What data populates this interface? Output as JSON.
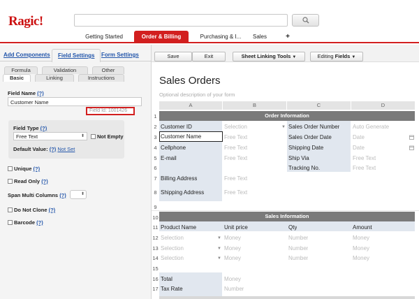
{
  "app": {
    "logo": "Ragic!"
  },
  "nav_tabs": [
    {
      "label": "Getting Started"
    },
    {
      "label": "Order & Billing"
    },
    {
      "label": "Purchasing & I..."
    },
    {
      "label": "Sales"
    },
    {
      "label": "+"
    }
  ],
  "left_panel": {
    "top_tabs": [
      "Add Components",
      "Field Settings",
      "Form Settings"
    ],
    "sub_tabs_row1": [
      "Formula",
      "Validation",
      "Other"
    ],
    "sub_tabs_row2": [
      "Basic",
      "Linking",
      "Instructions"
    ],
    "field_name_label": "Field Name",
    "help": "(?)",
    "field_name_value": "Customer Name",
    "field_id": "Field Id: 1001426",
    "field_type_label": "Field Type",
    "field_type_value": "Free Text",
    "not_empty_label": "Not Empty",
    "default_value_label": "Default Value:",
    "not_set": "Not Set",
    "unique_label": "Unique",
    "read_only_label": "Read Only",
    "span_label": "Span Multi Columns",
    "do_not_clone_label": "Do Not Clone",
    "barcode_label": "Barcode"
  },
  "toolbar": {
    "save": "Save",
    "exit": "Exit",
    "sheet_linking": "Sheet Linking Tools",
    "editing_prefix": "Editing",
    "editing_bold": "Fields"
  },
  "form": {
    "title": "Sales Orders",
    "description": "Optional description of your form"
  },
  "sheet": {
    "columns": [
      "A",
      "B",
      "C",
      "D"
    ],
    "rows": [
      "1",
      "2",
      "3",
      "4",
      "5",
      "6",
      "7",
      "8",
      "9",
      "10",
      "11",
      "12",
      "13",
      "14",
      "15",
      "16",
      "17"
    ],
    "sections": {
      "order": "Order Information",
      "sales": "Sales Information"
    },
    "a_labels": {
      "customer_id": "Customer ID",
      "customer_name": "Customer Name",
      "cellphone": "Cellphone",
      "email": "E-mail",
      "billing": "Billing Address",
      "shipping": "Shipping Address",
      "product": "Product Name",
      "total": "Total",
      "tax": "Tax Rate"
    },
    "b_values": {
      "selection": "Selection",
      "free_text": "Free Text",
      "unit_price": "Unit price",
      "money": "Money",
      "number": "Number"
    },
    "c_labels": {
      "sales_order_number": "Sales Order Number",
      "sales_order_date": "Sales Order Date",
      "shipping_date": "Shipping Date",
      "ship_via": "Ship Via",
      "tracking": "Tracking No.",
      "qty": "Qty",
      "number": "Number"
    },
    "d_values": {
      "auto": "Auto Generate",
      "date": "Date",
      "free_text": "Free Text",
      "amount": "Amount",
      "money": "Money"
    }
  },
  "colors": {
    "accent": "#d21f1f",
    "link": "#2255aa",
    "section": "#7a7a7a",
    "label_bg": "#e1e7ef"
  }
}
